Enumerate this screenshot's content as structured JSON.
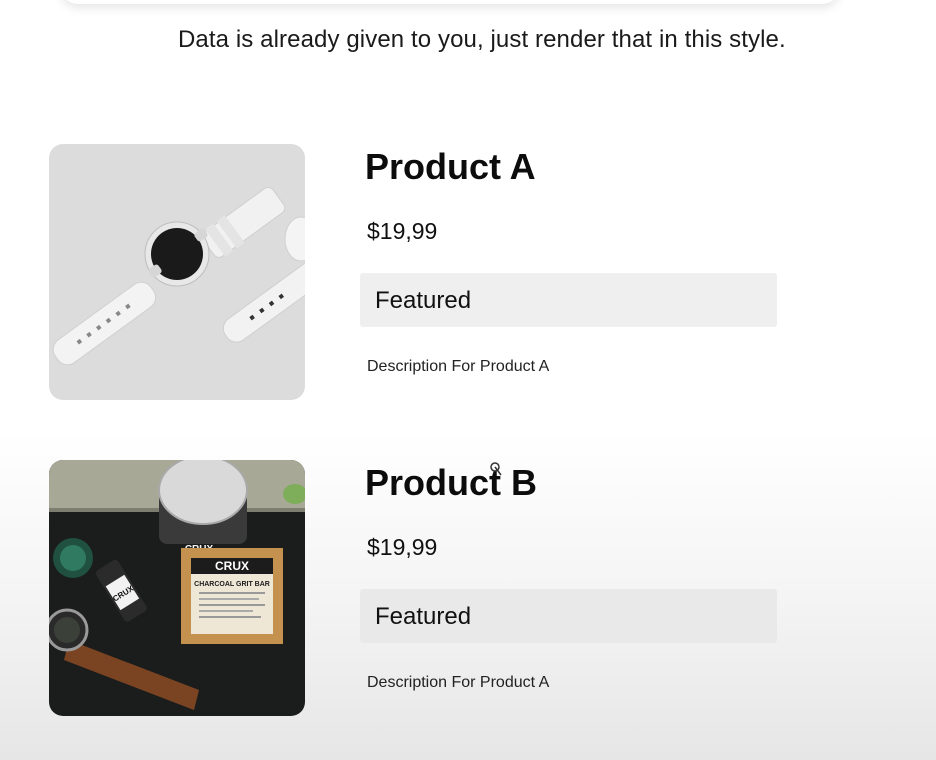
{
  "instruction": "Data is already given to you, just render that in this style.",
  "products": [
    {
      "name": "Product A",
      "price": "$19,99",
      "tag": "Featured",
      "description": "Description For Product A",
      "image_alt": "white smartwatch on grey background"
    },
    {
      "name": "Product B",
      "price": "$19,99",
      "tag": "Featured",
      "description": "Description For Product A",
      "image_alt": "grooming kit: CRUX jar, CRUX charcoal grit bar, bottle and watch on dark background",
      "image_text": {
        "jar": "CRUX",
        "box_brand": "CRUX",
        "box_product": "CHARCOAL GRIT BAR",
        "bottle": "CRUX"
      }
    }
  ]
}
